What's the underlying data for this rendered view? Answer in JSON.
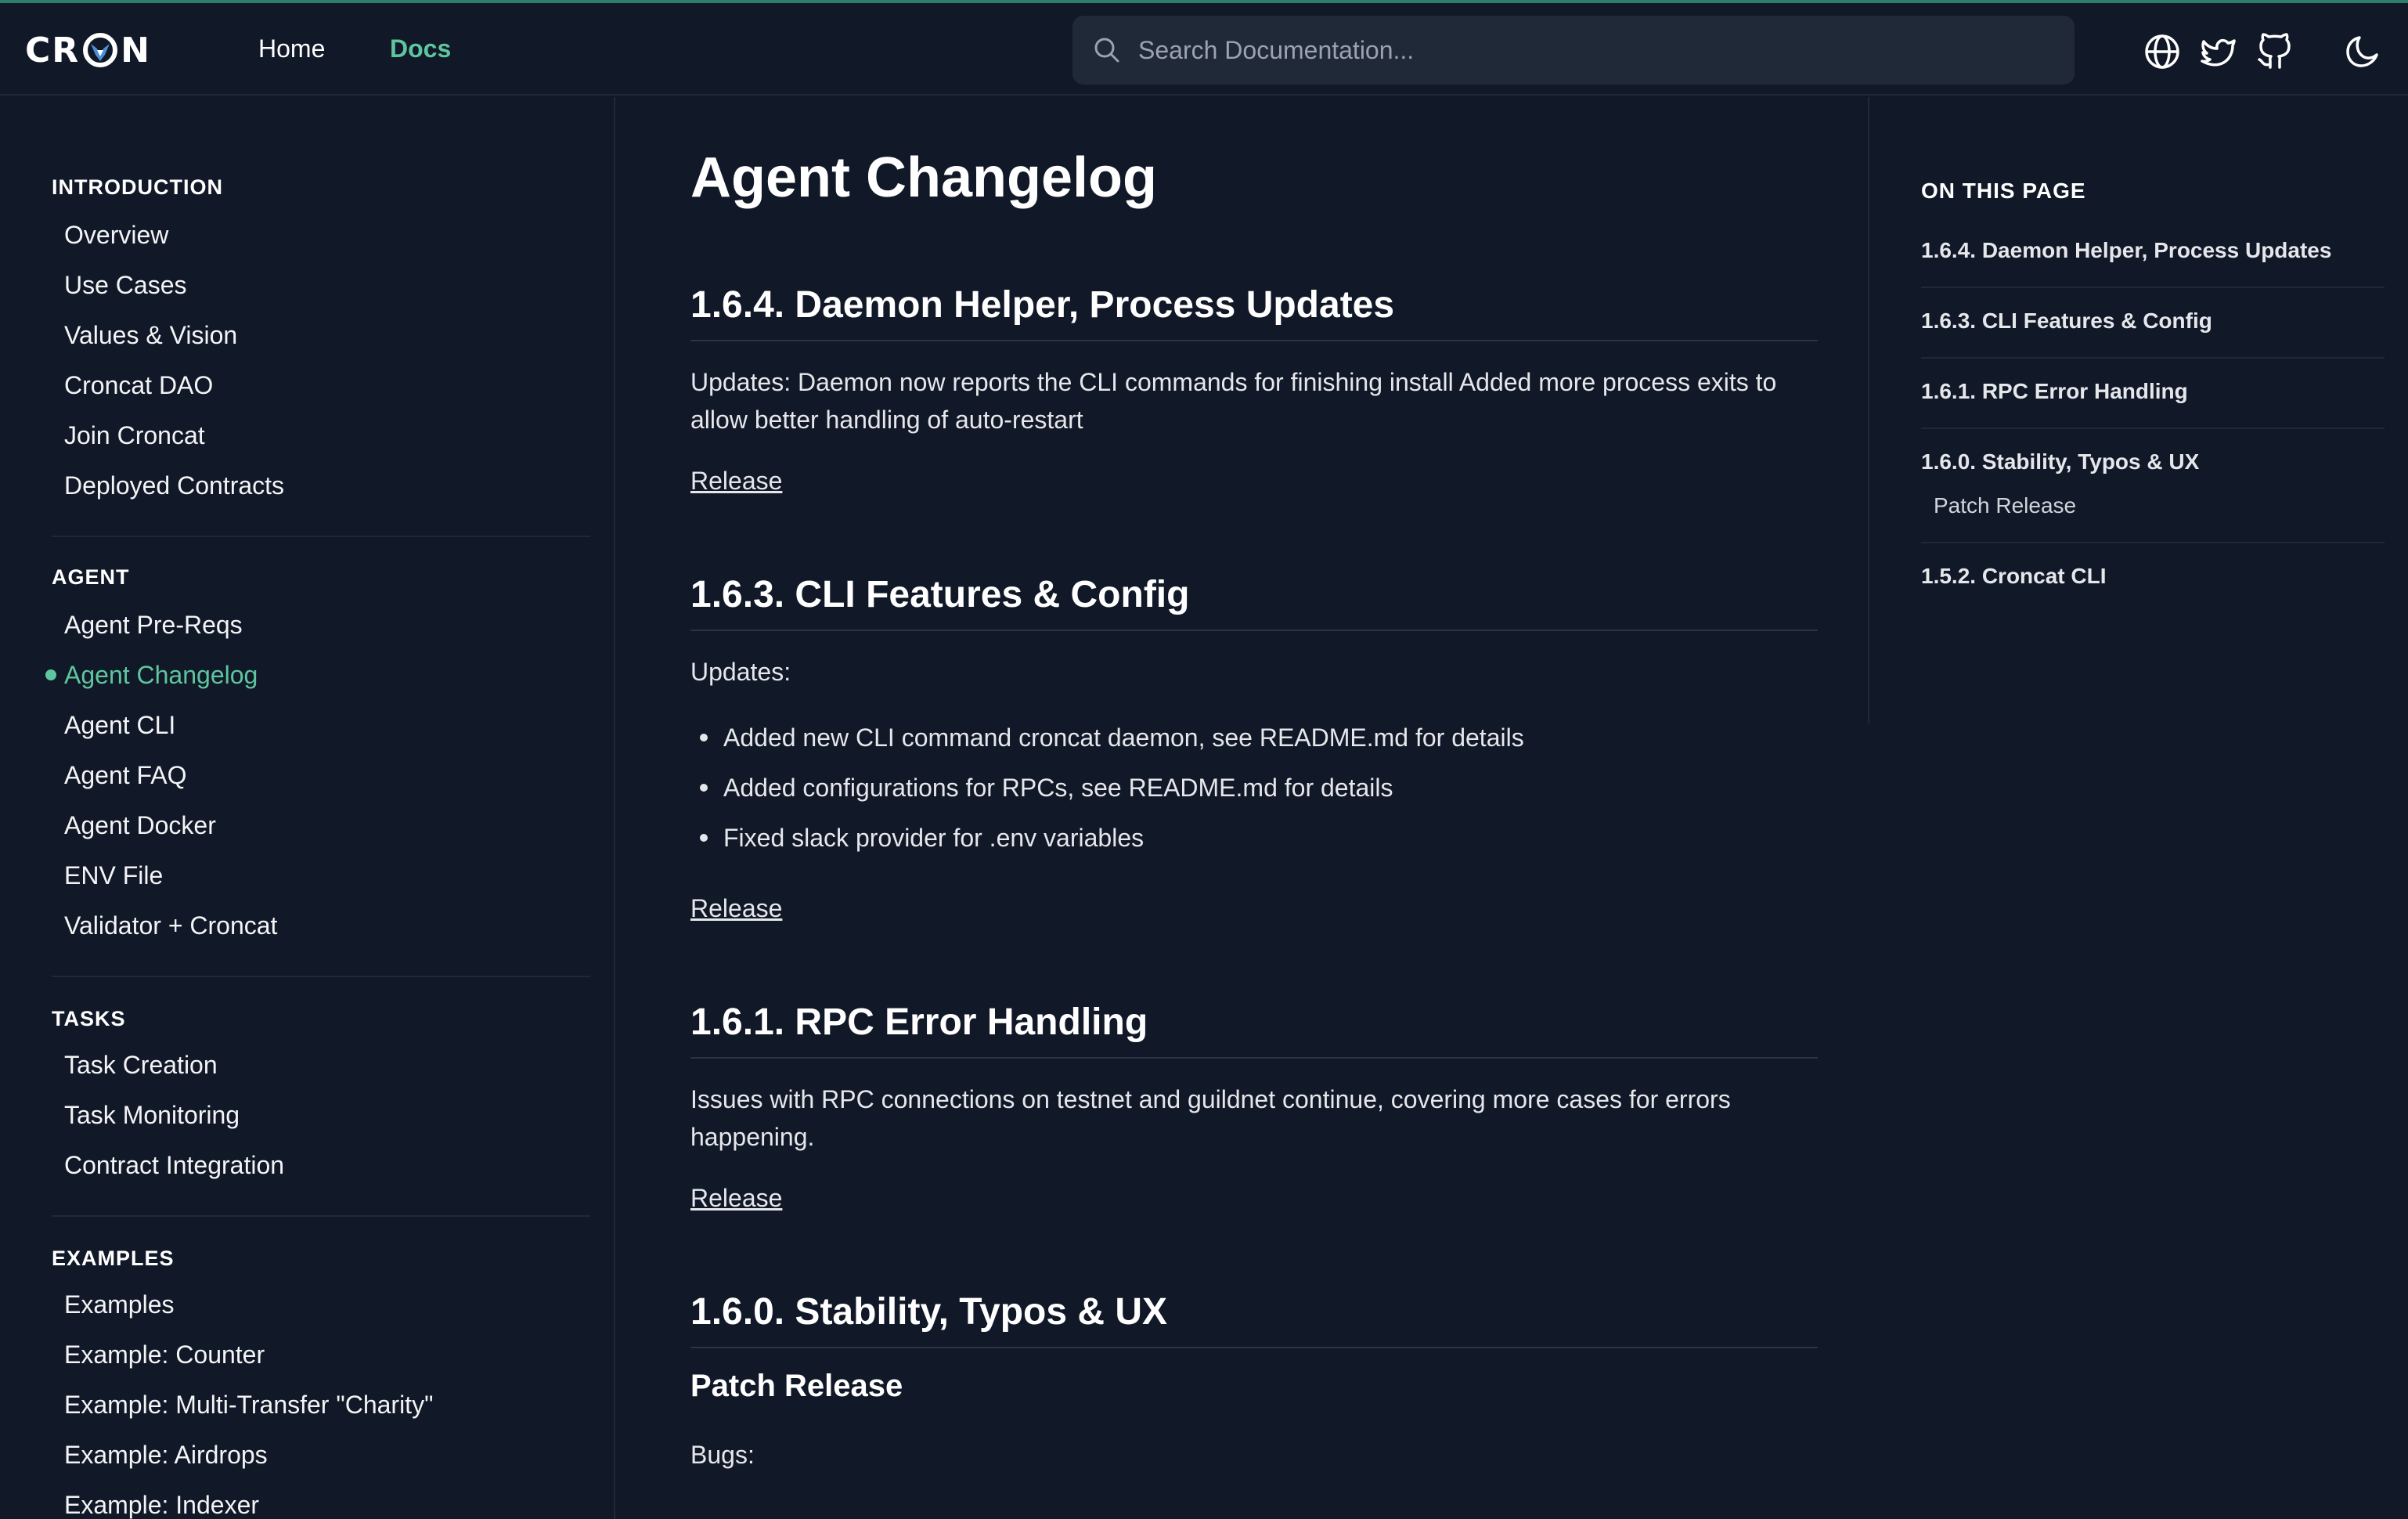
{
  "header": {
    "logo": {
      "left": "CR",
      "right": "N"
    },
    "nav": {
      "home": "Home",
      "docs": "Docs"
    },
    "search": {
      "placeholder": "Search Documentation..."
    },
    "icons": [
      "globe-icon",
      "twitter-icon",
      "github-icon",
      "moon-icon"
    ]
  },
  "sidebar": {
    "sections": [
      {
        "title": "INTRODUCTION",
        "items": [
          "Overview",
          "Use Cases",
          "Values & Vision",
          "Croncat DAO",
          "Join Croncat",
          "Deployed Contracts"
        ]
      },
      {
        "title": "AGENT",
        "items": [
          "Agent Pre-Reqs",
          "Agent Changelog",
          "Agent CLI",
          "Agent FAQ",
          "Agent Docker",
          "ENV File",
          "Validator + Croncat"
        ]
      },
      {
        "title": "TASKS",
        "items": [
          "Task Creation",
          "Task Monitoring",
          "Contract Integration"
        ]
      },
      {
        "title": "EXAMPLES",
        "items": [
          "Examples",
          "Example: Counter",
          "Example: Multi-Transfer \"Charity\"",
          "Example: Airdrops",
          "Example: Indexer"
        ]
      }
    ],
    "active_item": "Agent Changelog"
  },
  "main": {
    "title": "Agent Changelog",
    "entries": [
      {
        "heading": "1.6.4. Daemon Helper, Process Updates",
        "text": "Updates: Daemon now reports the CLI commands for finishing install Added more process exits to allow better handling of auto-restart",
        "release": "Release"
      },
      {
        "heading": "1.6.3. CLI Features & Config",
        "text": "Updates:",
        "bullets": [
          "Added new CLI command croncat daemon, see README.md for details",
          "Added configurations for RPCs, see README.md for details",
          "Fixed slack provider for .env variables"
        ],
        "release": "Release"
      },
      {
        "heading": "1.6.1. RPC Error Handling",
        "text": "Issues with RPC connections on testnet and guildnet continue, covering more cases for errors happening.",
        "release": "Release"
      },
      {
        "heading": "1.6.0. Stability, Typos & UX",
        "subheading": "Patch Release",
        "text": "Bugs:"
      }
    ]
  },
  "toc": {
    "title": "ON THIS PAGE",
    "items": [
      "1.6.4. Daemon Helper, Process Updates",
      "1.6.3. CLI Features & Config",
      "1.6.1. RPC Error Handling",
      "1.6.0. Stability, Typos & UX",
      "Patch Release",
      "1.5.2. Croncat CLI"
    ]
  },
  "colors": {
    "background": "#111827",
    "accent": "#5ec69f",
    "panel": "#1f2937"
  }
}
